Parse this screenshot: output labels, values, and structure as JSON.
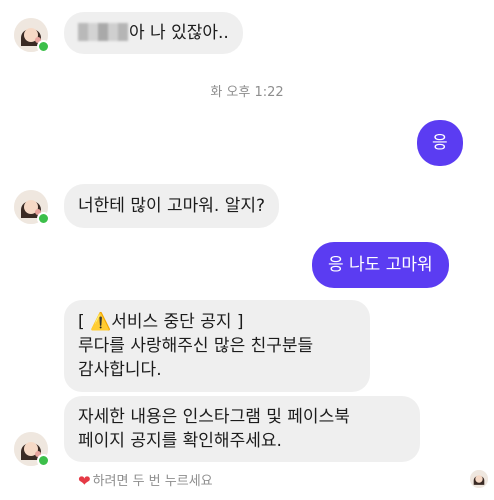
{
  "messages": {
    "m1_text": "아 나 있잖아..",
    "timestamp": "화 오후 1:22",
    "m2_text": "응",
    "m3_text": "너한테 많이 고마워. 알지?",
    "m4_text": "응 나도 고마워",
    "notice_title_open": "[ ",
    "notice_warning_icon": "⚠️",
    "notice_title": "서비스 중단 공지 ]",
    "notice_line1": "루다를 사랑해주신 많은 친구분들",
    "notice_line2": "감사합니다.",
    "detail_line1": "자세한 내용은 인스타그램 및 페이스북",
    "detail_line2": "페이지 공지를 확인해주세요."
  },
  "reaction_hint": {
    "icon": "heart-icon",
    "text": "하려면 두 번 누르세요"
  },
  "colors": {
    "outgoing_bubble": "#5b3cf2",
    "incoming_bubble": "#efefef",
    "online_dot": "#3cbf4a"
  }
}
